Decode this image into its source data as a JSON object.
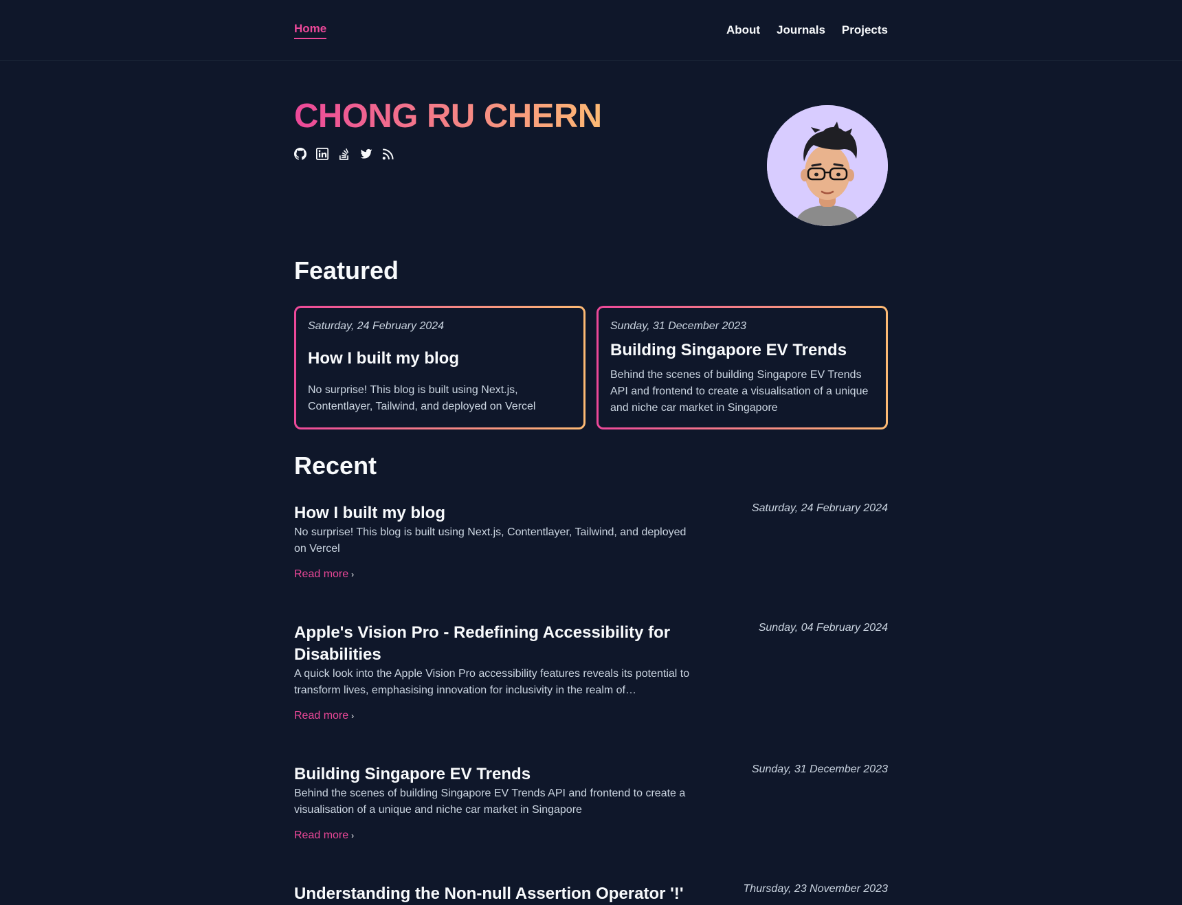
{
  "nav": {
    "home": "Home",
    "links": [
      "About",
      "Journals",
      "Projects"
    ]
  },
  "hero": {
    "name": "CHONG RU CHERN",
    "socials": [
      "github-icon",
      "linkedin-icon",
      "stackoverflow-icon",
      "twitter-icon",
      "rss-icon"
    ]
  },
  "featured": {
    "heading": "Featured",
    "cards": [
      {
        "date": "Saturday, 24 February 2024",
        "title": "How I built my blog",
        "desc": "No surprise! This blog is built using Next.js, Contentlayer, Tailwind, and deployed on Vercel"
      },
      {
        "date": "Sunday, 31 December 2023",
        "title": "Building Singapore EV Trends",
        "desc": "Behind the scenes of building Singapore EV Trends API and frontend to create a visualisation of a unique and niche car market in Singapore"
      }
    ]
  },
  "recent": {
    "heading": "Recent",
    "read_more": "Read more",
    "posts": [
      {
        "title": "How I built my blog",
        "desc": "No surprise! This blog is built using Next.js, Contentlayer, Tailwind, and deployed on Vercel",
        "date": "Saturday, 24 February 2024"
      },
      {
        "title": "Apple's Vision Pro - Redefining Accessibility for Disabilities",
        "desc": "A quick look into the Apple Vision Pro accessibility features reveals its potential to transform lives, emphasising innovation for inclusivity in the realm of…",
        "date": "Sunday, 04 February 2024"
      },
      {
        "title": "Building Singapore EV Trends",
        "desc": "Behind the scenes of building Singapore EV Trends API and frontend to create a visualisation of a unique and niche car market in Singapore",
        "date": "Sunday, 31 December 2023"
      },
      {
        "title": "Understanding the Non-null Assertion Operator '!'",
        "desc": "",
        "date": "Thursday, 23 November 2023"
      }
    ]
  },
  "colors": {
    "accent": "#ec4899",
    "accent_end": "#fdba74",
    "background": "#0f172a"
  }
}
